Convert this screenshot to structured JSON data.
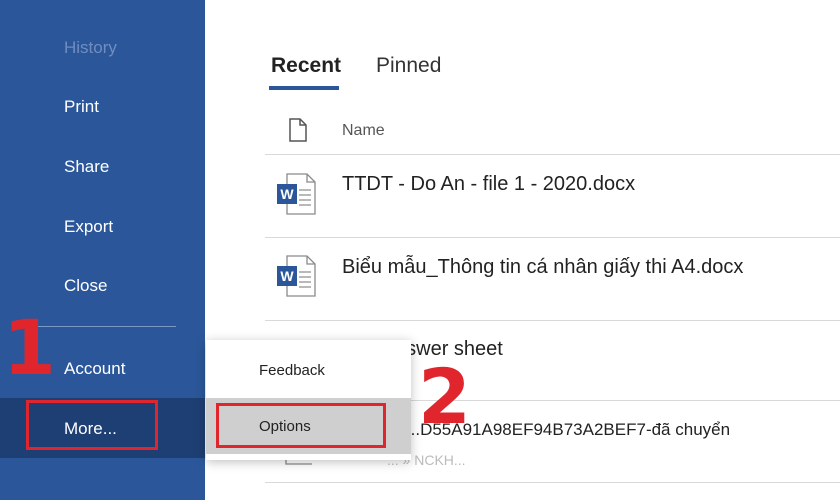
{
  "sidebar": {
    "items": [
      {
        "label": "History",
        "dim": true
      },
      {
        "label": "Print"
      },
      {
        "label": "Share"
      },
      {
        "label": "Export"
      },
      {
        "label": "Close"
      },
      {
        "label": "Account"
      },
      {
        "label": "More..."
      }
    ]
  },
  "tabs": [
    {
      "label": "Recent",
      "active": true
    },
    {
      "label": "Pinned",
      "active": false
    }
  ],
  "file_list": {
    "column_header": "Name",
    "files": [
      {
        "name": "TTDT - Do An - file 1 - 2020.docx"
      },
      {
        "name": "Biểu mẫu_Thông tin cá nhân giấy thi A4.docx"
      },
      {
        "name": "nswer sheet"
      },
      {
        "name": "...8..D55A91A98EF94B73A2BEF7-đã chuyển",
        "sub": "... » NCKH..."
      }
    ]
  },
  "popup_menu": {
    "items": [
      {
        "label": "Feedback"
      },
      {
        "label": "Options",
        "selected": true
      }
    ]
  },
  "annotations": {
    "step1": "1",
    "step2": "2",
    "highlight_color": "#e0262c"
  },
  "colors": {
    "sidebar_bg": "#2b579a",
    "accent": "#2b579a",
    "word_blue": "#2b579a"
  }
}
